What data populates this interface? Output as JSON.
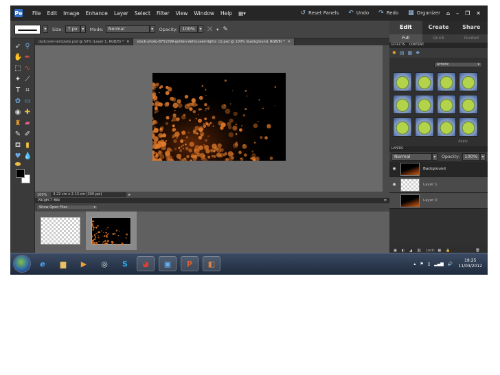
{
  "menubar": {
    "items": [
      "File",
      "Edit",
      "Image",
      "Enhance",
      "Layer",
      "Select",
      "Filter",
      "View",
      "Window",
      "Help"
    ],
    "reset_panels": "Reset Panels",
    "undo": "Undo",
    "redo": "Redo",
    "organizer": "Organizer"
  },
  "options": {
    "size_label": "Size:",
    "size_value": "7 px",
    "mode_label": "Mode:",
    "mode_value": "Normal",
    "opacity_label": "Opacity:",
    "opacity_value": "100%"
  },
  "doc_tabs": [
    {
      "label": "dvdcover-template.psd @ 50% (Layer 1, RGB/8) *",
      "active": false
    },
    {
      "label": "stock-photo-8751099-golden-defocused-lights (1).psd @ 100% (background, RGB/8) *",
      "active": true
    }
  ],
  "status": {
    "zoom": "100%",
    "info": "3.22 cm x 2.13 cm (300 ppi)"
  },
  "project_bin": {
    "title": "PROJECT BIN",
    "select": "Show Open Files"
  },
  "right_panel": {
    "tabs": [
      "Edit",
      "Create",
      "Share"
    ],
    "modes": [
      "Full",
      "Quick",
      "Guided"
    ],
    "effects_tabs": [
      "EFFECTS",
      "CONTENT"
    ],
    "effects_select": "Artistic",
    "apply_label": "Apply",
    "layers_title": "LAYERS",
    "blend_mode": "Normal",
    "opacity_label": "Opacity:",
    "opacity_value": "100%",
    "layers": [
      {
        "name": "Background",
        "active": true
      },
      {
        "name": "Layer 1",
        "active": false
      },
      {
        "name": "Layer 0",
        "active": false
      }
    ],
    "lock_label": "Lock:"
  },
  "taskbar": {
    "time": "19:25",
    "date": "11/03/2012"
  },
  "colors": {
    "accent": "#2f6fc9",
    "bokeh": "#e07a2a"
  }
}
